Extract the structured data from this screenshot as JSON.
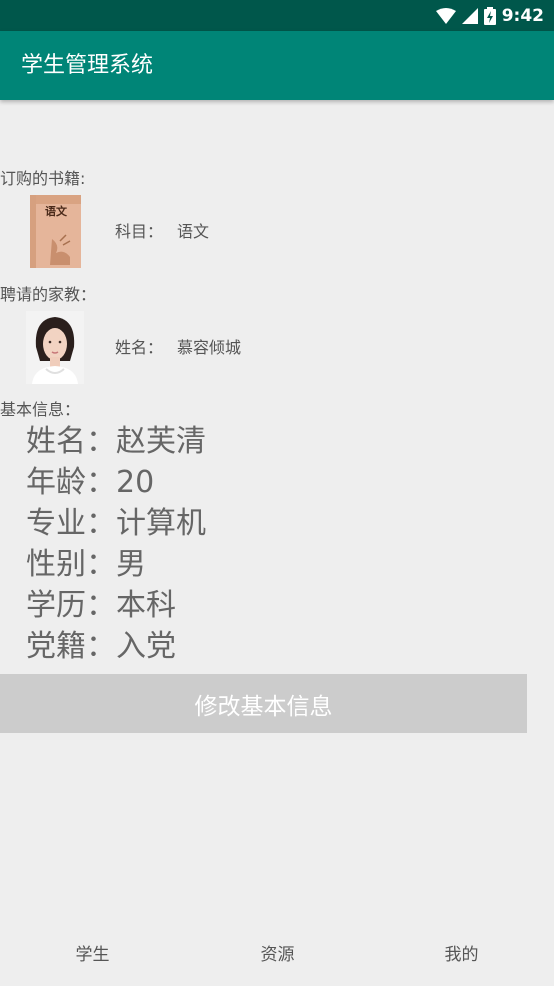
{
  "status_bar": {
    "time": "9:42",
    "icons": [
      "wifi-icon",
      "signal-icon",
      "battery-icon"
    ]
  },
  "app_bar": {
    "title": "学生管理系统"
  },
  "books": {
    "section_label": "订购的书籍:",
    "cover_text": "语文",
    "subject_label": "科目：",
    "subject_value": "语文"
  },
  "tutor": {
    "section_label": "聘请的家教：",
    "name_label": "姓名：",
    "name_value": "慕容倾城"
  },
  "basic_info": {
    "section_label": "基本信息：",
    "fields": [
      {
        "label": "姓名：",
        "value": "赵芙清"
      },
      {
        "label": "年龄：",
        "value": "20"
      },
      {
        "label": "专业：",
        "value": "计算机"
      },
      {
        "label": "性别：",
        "value": "男"
      },
      {
        "label": "学历：",
        "value": "本科"
      },
      {
        "label": "党籍：",
        "value": "入党"
      }
    ]
  },
  "edit_button": {
    "label": "修改基本信息"
  },
  "bottom_nav": {
    "items": [
      "学生",
      "资源",
      "我的"
    ]
  },
  "colors": {
    "status_bar": "#00574b",
    "app_bar": "#008577",
    "background": "#eeeeee",
    "button": "#cccccc"
  }
}
